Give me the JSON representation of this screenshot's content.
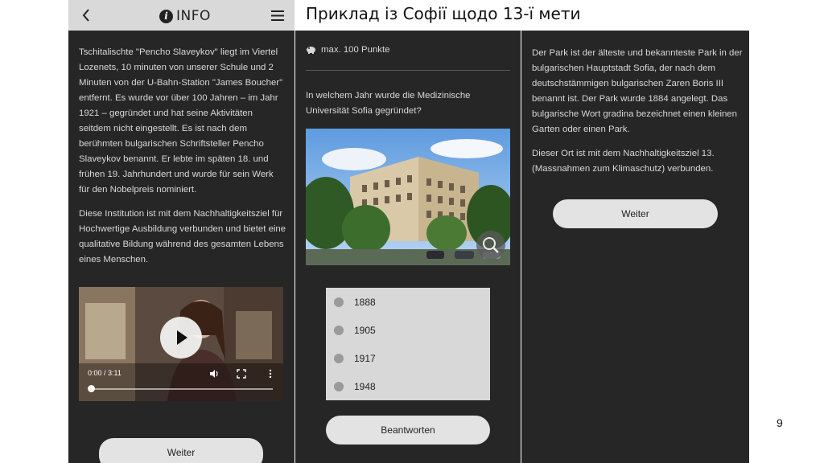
{
  "slide": {
    "title": "Приклад із Софії щодо 13-ї мети",
    "page_number": "9"
  },
  "screen1": {
    "header_title": "INFO",
    "paragraph1": "Tschitalischte \"Pencho Slaveykov\" liegt im Viertel Lozenets, 10 minuten von unserer Schule und 2 Minuten von der U-Bahn-Station \"James Boucher\" entfernt. Es wurde vor über 100 Jahren – im Jahr 1921 – gegründet und hat seine Aktivitäten seitdem nicht eingestellt. Es ist nach dem berühmten bulgarischen Schriftsteller Pencho Slaveykov benannt. Er lebte im späten 18. und frühen 19. Jahrhundert und wurde für sein Werk für den Nobelpreis nominiert.",
    "paragraph2": "Diese Institution ist mit dem Nachhaltigkeitsziel für Hochwertige Ausbildung verbunden und bietet eine qualitative Bildung während des gesamten Lebens eines Menschen.",
    "video": {
      "time": "0:00 / 3:11",
      "progress": 0
    },
    "button_label": "Weiter"
  },
  "screen2": {
    "points": "max. 100 Punkte",
    "question": "In welchem Jahr wurde die Medizinische Universität Sofia gegründet?",
    "options": [
      "1888",
      "1905",
      "1917",
      "1948"
    ],
    "submit_label": "Beantworten"
  },
  "screen3": {
    "paragraph1": "Der Park ist der älteste und bekannteste Park in der bulgarischen Hauptstadt Sofia, der nach dem deutschstämmigen bulgarischen Zaren Boris III benannt ist. Der Park wurde 1884 angelegt. Das bulgarische Wort gradina bezeichnet einen kleinen Garten oder einen Park.",
    "paragraph2": "Dieser Ort ist mit dem Nachhaltigkeitsziel 13. (Massnahmen zum Klimaschutz) verbunden.",
    "button_label": "Weiter"
  }
}
